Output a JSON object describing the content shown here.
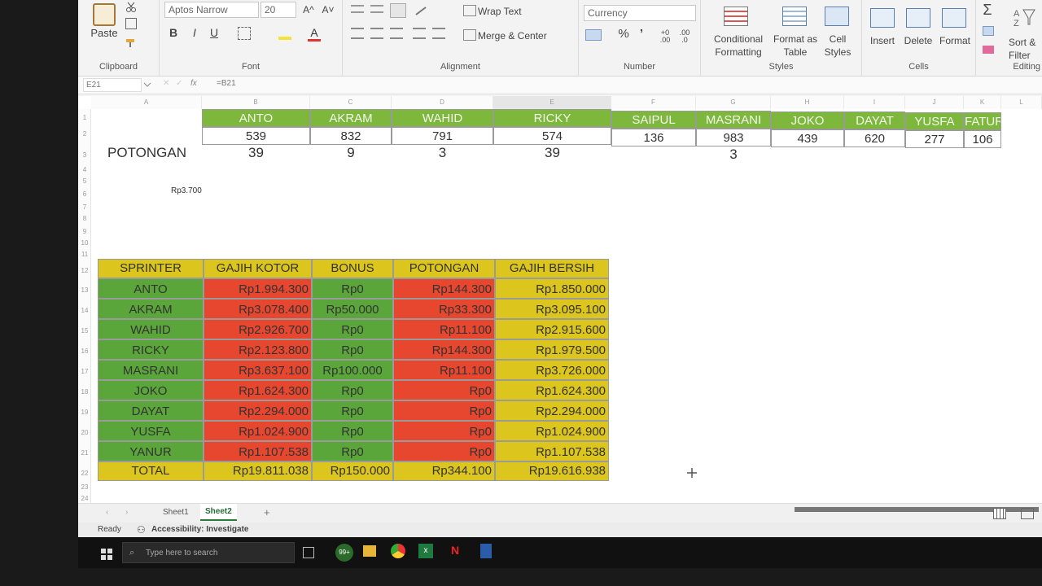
{
  "ribbon": {
    "clipboard": {
      "paste": "Paste",
      "label": "Clipboard"
    },
    "font": {
      "name": "Aptos Narrow",
      "size": "20",
      "bold": "B",
      "italic": "I",
      "underline": "U",
      "grow": "A^",
      "shrink": "A˅",
      "label": "Font"
    },
    "alignment": {
      "wrap_text": "Wrap Text",
      "merge_center": "Merge & Center",
      "label": "Alignment"
    },
    "number": {
      "format": "Currency",
      "percent": "%",
      "comma": "’",
      "label": "Number"
    },
    "styles": {
      "conditional_formatting": "Conditional Formatting",
      "format_as_table": "Format as Table",
      "cell_styles": "Cell Styles",
      "label": "Styles"
    },
    "cells": {
      "insert": "Insert",
      "delete": "Delete",
      "format": "Format",
      "label": "Cells"
    },
    "editing": {
      "sort_filter": "Sort & Filter",
      "label": "Editing",
      "sum": "Σ"
    }
  },
  "formula_bar": {
    "name_box": "E21",
    "fx": "fx",
    "formula": "=B21"
  },
  "columns": [
    "A",
    "B",
    "C",
    "D",
    "E",
    "F",
    "G",
    "H",
    "I",
    "J",
    "K",
    "L"
  ],
  "top_table": {
    "names": [
      "ANTO",
      "AKRAM",
      "WAHID",
      "RICKY",
      "SAIPUL",
      "MASRANI",
      "JOKO",
      "DAYAT",
      "YUSFA",
      "FATUR"
    ],
    "values": [
      "539",
      "832",
      "791",
      "574",
      "136",
      "983",
      "439",
      "620",
      "277",
      "106"
    ],
    "potongan_label": "POTONGAN",
    "potongan": [
      "39",
      "9",
      "3",
      "39",
      "",
      "3",
      "",
      "",
      "",
      ""
    ],
    "note": "Rp3.700"
  },
  "salary_table": {
    "headers": [
      "SPRINTER",
      "GAJIH KOTOR",
      "BONUS",
      "POTONGAN",
      "GAJIH BERSIH"
    ],
    "rows": [
      [
        "ANTO",
        "Rp1.994.300",
        "Rp0",
        "Rp144.300",
        "Rp1.850.000"
      ],
      [
        "AKRAM",
        "Rp3.078.400",
        "Rp50.000",
        "Rp33.300",
        "Rp3.095.100"
      ],
      [
        "WAHID",
        "Rp2.926.700",
        "Rp0",
        "Rp11.100",
        "Rp2.915.600"
      ],
      [
        "RICKY",
        "Rp2.123.800",
        "Rp0",
        "Rp144.300",
        "Rp1.979.500"
      ],
      [
        "MASRANI",
        "Rp3.637.100",
        "Rp100.000",
        "Rp11.100",
        "Rp3.726.000"
      ],
      [
        "JOKO",
        "Rp1.624.300",
        "Rp0",
        "Rp0",
        "Rp1.624.300"
      ],
      [
        "DAYAT",
        "Rp2.294.000",
        "Rp0",
        "Rp0",
        "Rp2.294.000"
      ],
      [
        "YUSFA",
        "Rp1.024.900",
        "Rp0",
        "Rp0",
        "Rp1.024.900"
      ],
      [
        "YANUR",
        "Rp1.107.538",
        "Rp0",
        "Rp0",
        "Rp1.107.538"
      ]
    ],
    "total": [
      "TOTAL",
      "Rp19.811.038",
      "Rp150.000",
      "Rp344.100",
      "Rp19.616.938"
    ]
  },
  "sheets": {
    "tabs": [
      "Sheet1",
      "Sheet2"
    ],
    "active": "Sheet2",
    "add": "+"
  },
  "status": {
    "ready": "Ready",
    "accessibility": "Accessibility: Investigate"
  },
  "taskbar": {
    "search_placeholder": "Type here to search",
    "badge": "99+"
  },
  "colors": {
    "header_green": "#7db73c",
    "green": "#5ba63a",
    "red": "#e8472f",
    "yellow": "#dcc51c"
  }
}
